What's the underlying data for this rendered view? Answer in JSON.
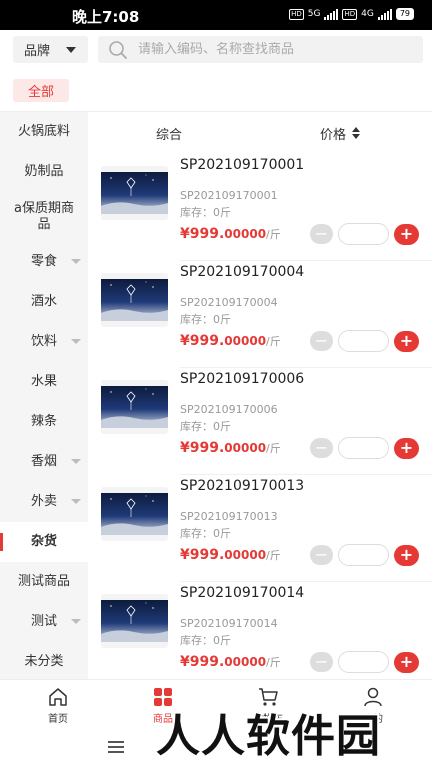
{
  "status_bar": {
    "time": "晚上7:08",
    "network_1": "5G",
    "network_2": "4G",
    "battery": "79"
  },
  "top_bar": {
    "brand_label": "品牌",
    "search_placeholder": "请输入编码、名称查找商品"
  },
  "category_tags": {
    "all_label": "全部"
  },
  "sidebar": {
    "items": [
      {
        "label": "火锅底料",
        "has_submenu": false
      },
      {
        "label": "奶制品",
        "has_submenu": false
      },
      {
        "label": "a保质期商品",
        "has_submenu": false
      },
      {
        "label": "零食",
        "has_submenu": true
      },
      {
        "label": "酒水",
        "has_submenu": false
      },
      {
        "label": "饮料",
        "has_submenu": true
      },
      {
        "label": "水果",
        "has_submenu": false
      },
      {
        "label": "辣条",
        "has_submenu": false
      },
      {
        "label": "香烟",
        "has_submenu": true
      },
      {
        "label": "外卖",
        "has_submenu": true
      },
      {
        "label": "杂货",
        "has_submenu": false,
        "active": true
      },
      {
        "label": "测试商品",
        "has_submenu": false
      },
      {
        "label": "测试",
        "has_submenu": true
      },
      {
        "label": "未分类",
        "has_submenu": false
      }
    ]
  },
  "sort_bar": {
    "general_label": "综合",
    "price_label": "价格"
  },
  "products": [
    {
      "sku": "SP202109170001",
      "code": "SP202109170001",
      "stock": "库存：0斤",
      "price_main": "¥999.",
      "price_decimal": "00000",
      "unit": "/斤",
      "minus": "−",
      "plus": "+"
    },
    {
      "sku": "SP202109170004",
      "code": "SP202109170004",
      "stock": "库存：0斤",
      "price_main": "¥999.",
      "price_decimal": "00000",
      "unit": "/斤",
      "minus": "−",
      "plus": "+"
    },
    {
      "sku": "SP202109170006",
      "code": "SP202109170006",
      "stock": "库存：0斤",
      "price_main": "¥999.",
      "price_decimal": "00000",
      "unit": "/斤",
      "minus": "−",
      "plus": "+"
    },
    {
      "sku": "SP202109170013",
      "code": "SP202109170013",
      "stock": "库存：0斤",
      "price_main": "¥999.",
      "price_decimal": "00000",
      "unit": "/斤",
      "minus": "−",
      "plus": "+"
    },
    {
      "sku": "SP202109170014",
      "code": "SP202109170014",
      "stock": "库存：0斤",
      "price_main": "¥999.",
      "price_decimal": "00000",
      "unit": "/斤",
      "minus": "−",
      "plus": "+"
    }
  ],
  "tab_bar": {
    "tabs": [
      {
        "label": "首页",
        "icon": "home-icon"
      },
      {
        "label": "商品",
        "icon": "grid-icon",
        "active": true
      },
      {
        "label": "购物车",
        "icon": "cart-icon"
      },
      {
        "label": "我的",
        "icon": "user-icon"
      }
    ]
  },
  "watermark": "人人软件园",
  "colors": {
    "accent": "#e53935",
    "sidebar_bg": "#f5f5f5",
    "tag_bg": "#fde8e8"
  }
}
